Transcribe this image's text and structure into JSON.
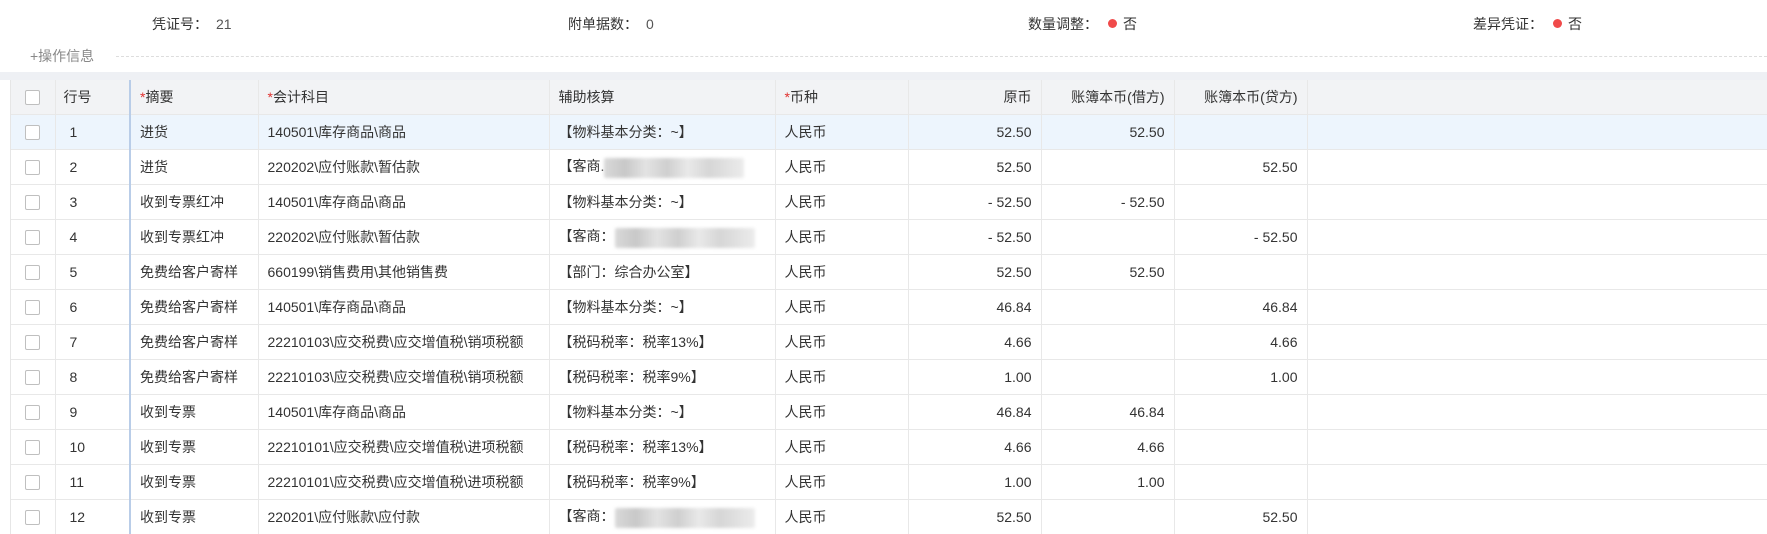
{
  "header": {
    "voucher_no_label": "凭证号：",
    "voucher_no_value": "21",
    "attachments_label": "附单据数：",
    "attachments_value": "0",
    "qty_adjust_label": "数量调整：",
    "qty_adjust_value": "否",
    "diff_voucher_label": "差异凭证：",
    "diff_voucher_value": "否",
    "status_dot_color": "#f04a4a"
  },
  "operation_info_label": "+操作信息",
  "table": {
    "columns": {
      "row_no": "行号",
      "summary": "摘要",
      "account": "会计科目",
      "aux": "辅助核算",
      "currency": "币种",
      "original": "原币",
      "debit": "账簿本币(借方)",
      "credit": "账簿本币(贷方)"
    },
    "required_mark": "*",
    "rows": [
      {
        "no": "1",
        "summary": "进货",
        "account": "140501\\库存商品\\商品",
        "aux": "【物料基本分类：~】",
        "currency": "人民币",
        "original": "52.50",
        "debit": "52.50",
        "credit": ""
      },
      {
        "no": "2",
        "summary": "进货",
        "account": "220202\\应付账款\\暂估款",
        "aux": "【客商.",
        "currency": "人民币",
        "original": "52.50",
        "debit": "",
        "credit": "52.50"
      },
      {
        "no": "3",
        "summary": "收到专票红冲",
        "account": "140501\\库存商品\\商品",
        "aux": "【物料基本分类：~】",
        "currency": "人民币",
        "original": "- 52.50",
        "debit": "- 52.50",
        "credit": ""
      },
      {
        "no": "4",
        "summary": "收到专票红冲",
        "account": "220202\\应付账款\\暂估款",
        "aux": "【客商：",
        "currency": "人民币",
        "original": "- 52.50",
        "debit": "",
        "credit": "- 52.50"
      },
      {
        "no": "5",
        "summary": "免费给客户寄样",
        "account": "660199\\销售费用\\其他销售费",
        "aux": "【部门：综合办公室】",
        "currency": "人民币",
        "original": "52.50",
        "debit": "52.50",
        "credit": ""
      },
      {
        "no": "6",
        "summary": "免费给客户寄样",
        "account": "140501\\库存商品\\商品",
        "aux": "【物料基本分类：~】",
        "currency": "人民币",
        "original": "46.84",
        "debit": "",
        "credit": "46.84"
      },
      {
        "no": "7",
        "summary": "免费给客户寄样",
        "account": "22210103\\应交税费\\应交增值税\\销项税额",
        "aux": "【税码税率：税率13%】",
        "currency": "人民币",
        "original": "4.66",
        "debit": "",
        "credit": "4.66"
      },
      {
        "no": "8",
        "summary": "免费给客户寄样",
        "account": "22210103\\应交税费\\应交增值税\\销项税额",
        "aux": "【税码税率：税率9%】",
        "currency": "人民币",
        "original": "1.00",
        "debit": "",
        "credit": "1.00"
      },
      {
        "no": "9",
        "summary": "收到专票",
        "account": "140501\\库存商品\\商品",
        "aux": "【物料基本分类：~】",
        "currency": "人民币",
        "original": "46.84",
        "debit": "46.84",
        "credit": ""
      },
      {
        "no": "10",
        "summary": "收到专票",
        "account": "22210101\\应交税费\\应交增值税\\进项税额",
        "aux": "【税码税率：税率13%】",
        "currency": "人民币",
        "original": "4.66",
        "debit": "4.66",
        "credit": ""
      },
      {
        "no": "11",
        "summary": "收到专票",
        "account": "22210101\\应交税费\\应交增值税\\进项税额",
        "aux": "【税码税率：税率9%】",
        "currency": "人民币",
        "original": "1.00",
        "debit": "1.00",
        "credit": ""
      },
      {
        "no": "12",
        "summary": "收到专票",
        "account": "220201\\应付账款\\应付款",
        "aux": "【客商：",
        "currency": "人民币",
        "original": "52.50",
        "debit": "",
        "credit": "52.50"
      }
    ]
  }
}
